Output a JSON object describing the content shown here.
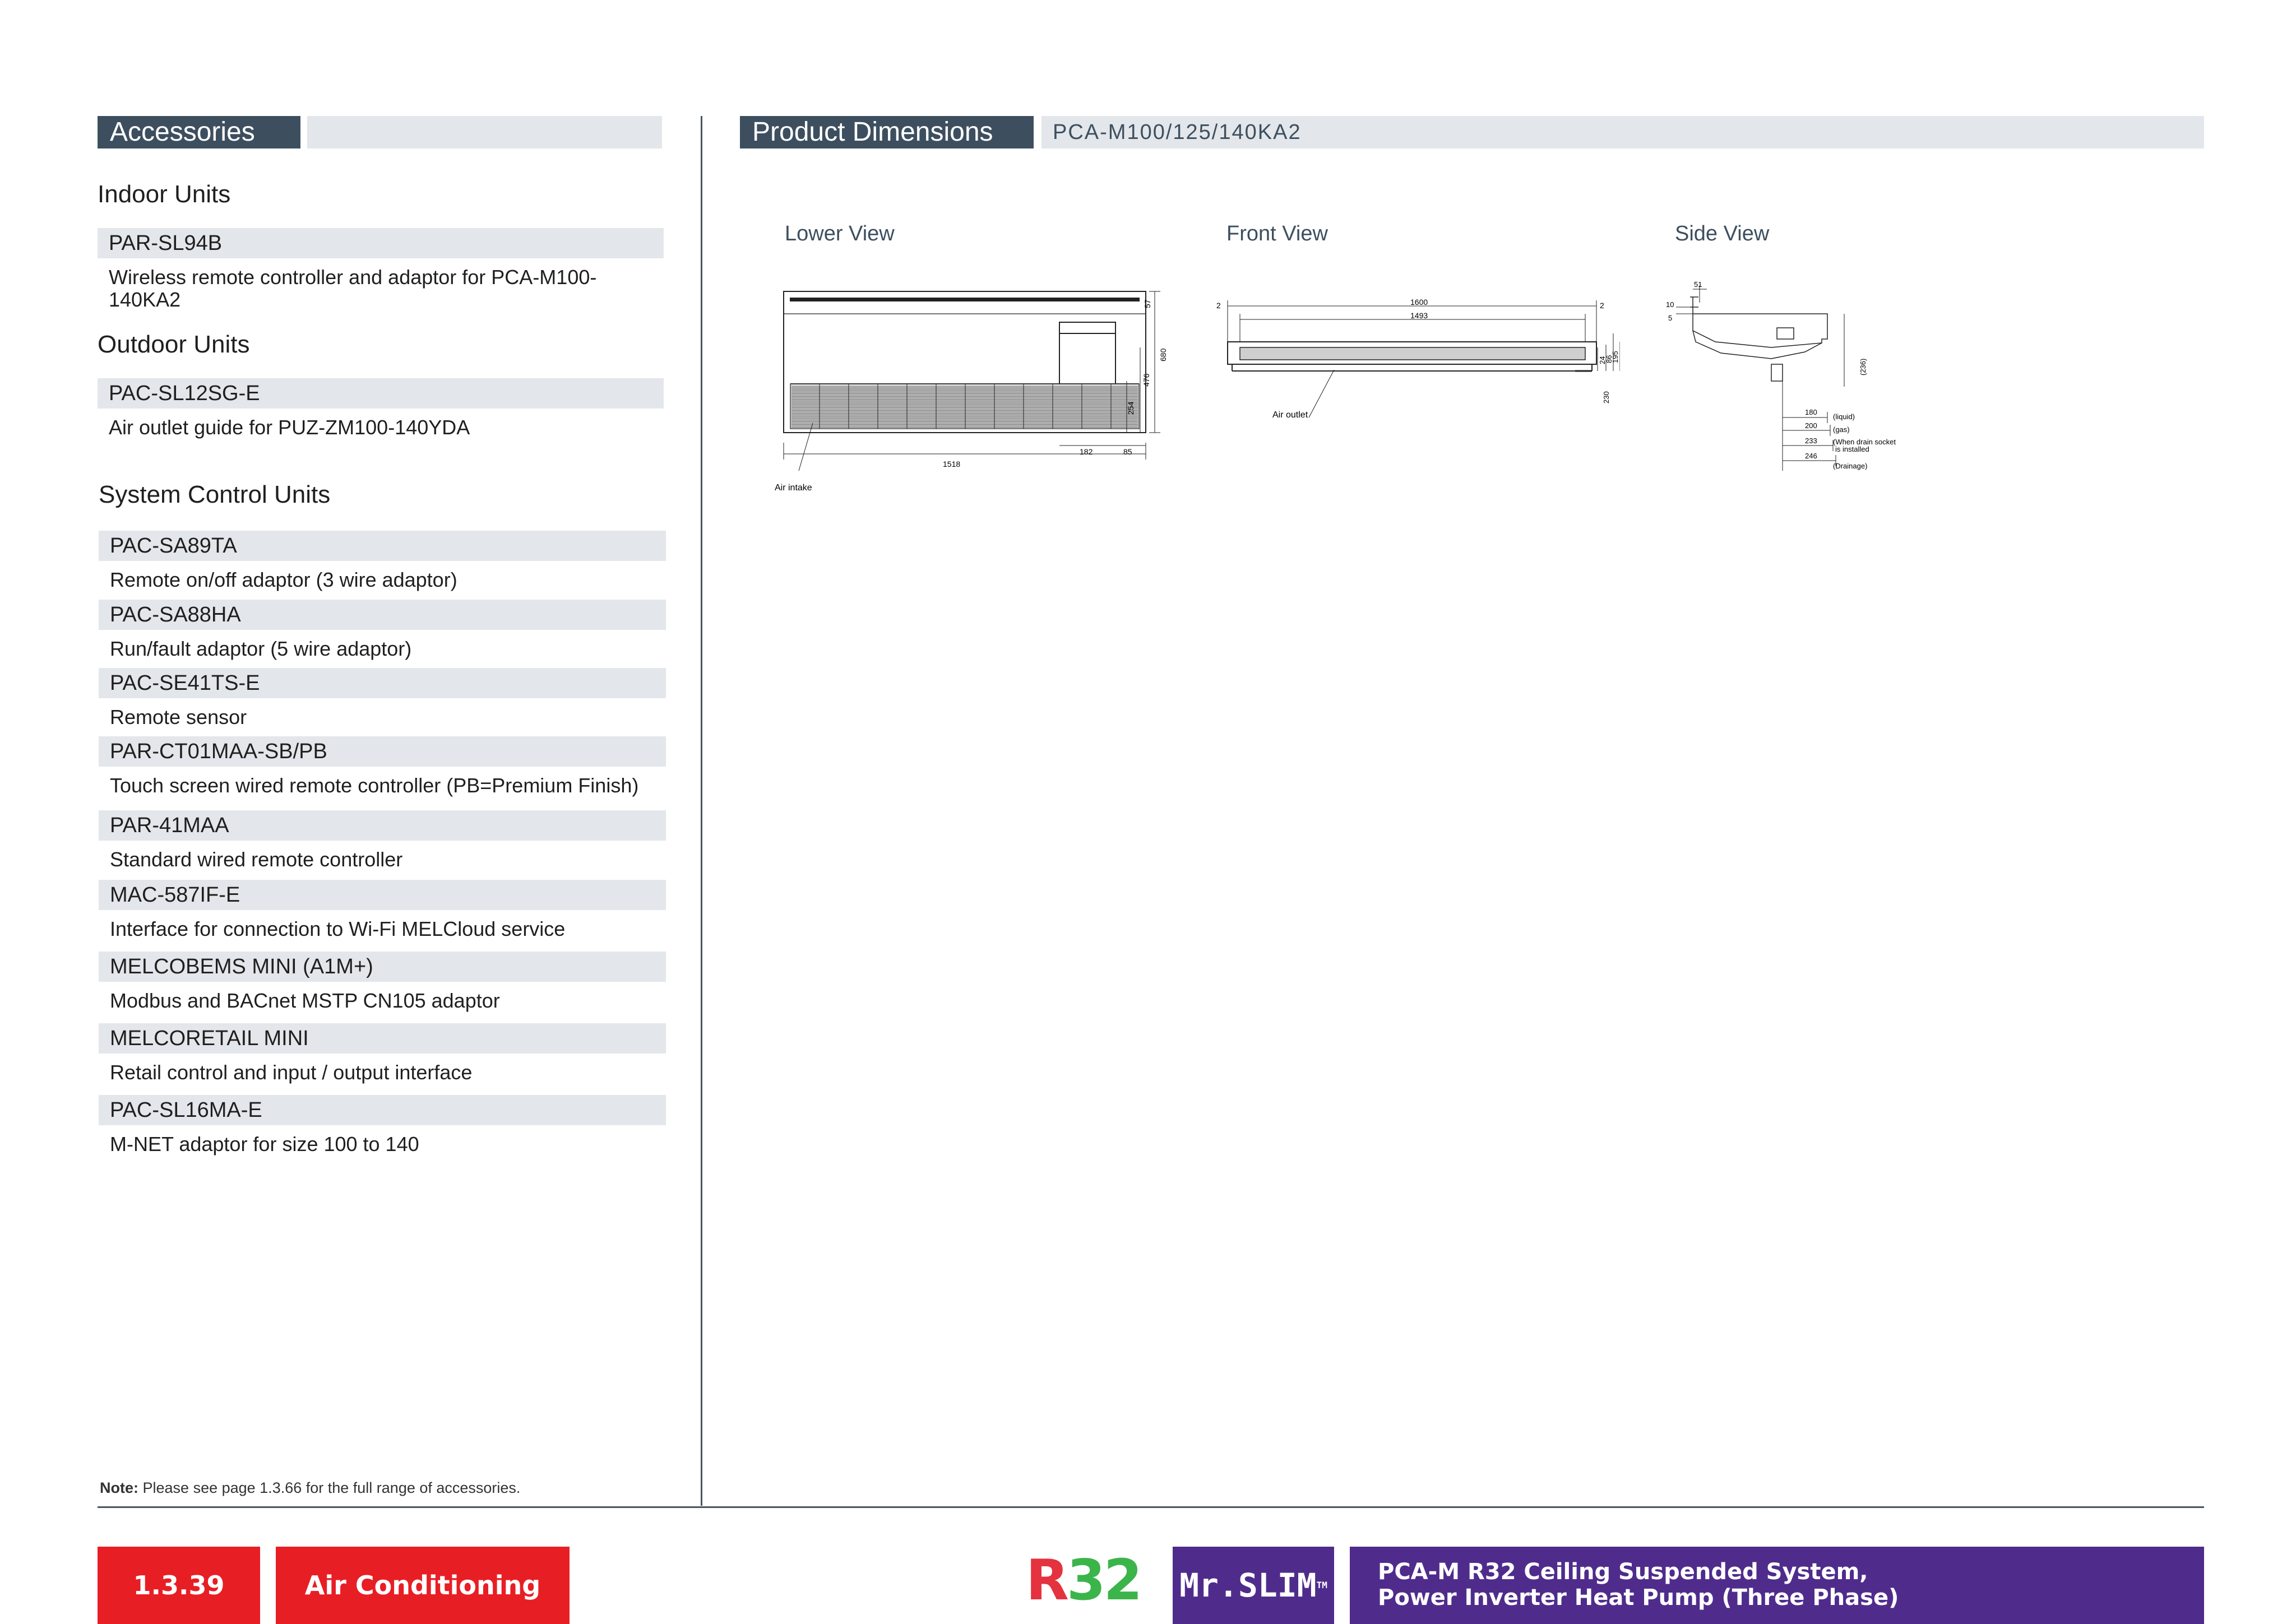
{
  "accessories": {
    "header": "Accessories",
    "indoor": {
      "title": "Indoor Units",
      "items": [
        {
          "code": "PAR-SL94B",
          "desc": "Wireless remote controller and adaptor for PCA-M100-140KA2"
        }
      ]
    },
    "outdoor": {
      "title": "Outdoor Units",
      "items": [
        {
          "code": "PAC-SL12SG-E",
          "desc": "Air outlet guide for PUZ-ZM100-140YDA"
        }
      ]
    },
    "system": {
      "title": "System Control Units",
      "items": [
        {
          "code": "PAC-SA89TA",
          "desc": "Remote on/off adaptor (3 wire adaptor)"
        },
        {
          "code": "PAC-SA88HA",
          "desc": "Run/fault adaptor (5 wire adaptor)"
        },
        {
          "code": "PAC-SE41TS-E",
          "desc": "Remote sensor"
        },
        {
          "code": "PAR-CT01MAA-SB/PB",
          "desc": "Touch screen wired remote controller (PB=Premium Finish)"
        },
        {
          "code": "PAR-41MAA",
          "desc": "Standard wired remote controller"
        },
        {
          "code": "MAC-587IF-E",
          "desc": "Interface for connection to Wi-Fi MELCloud service"
        },
        {
          "code": "MELCOBEMS MINI (A1M+)",
          "desc": "Modbus and BACnet MSTP CN105 adaptor"
        },
        {
          "code": "MELCORETAIL MINI",
          "desc": "Retail control and input / output interface"
        },
        {
          "code": "PAC-SL16MA-E",
          "desc": "M-NET adaptor for size 100 to 140"
        }
      ]
    },
    "note_label": "Note:",
    "note_text": "Please see page 1.3.66 for the full range of accessories."
  },
  "dimensions": {
    "header": "Product Dimensions",
    "model": "PCA-M100/125/140KA2",
    "lower_view": {
      "title": "Lower View",
      "labels": {
        "d680": "680",
        "d476": "476",
        "d57": "57",
        "d254": "254",
        "d182": "182",
        "d85": "85",
        "d1518": "1518",
        "air_intake": "Air intake"
      }
    },
    "front_view": {
      "title": "Front View",
      "labels": {
        "d1600": "1600",
        "d1493": "1493",
        "d2a": "2",
        "d2b": "2",
        "d230": "230",
        "d195": "195",
        "d86": "86",
        "d24": "24",
        "air_outlet": "Air outlet"
      }
    },
    "side_view": {
      "title": "Side View",
      "labels": {
        "d51": "51",
        "d10": "10",
        "d5": "5",
        "d236": "(236)",
        "d180": "180",
        "d200": "200",
        "d233": "233",
        "d246": "246",
        "liquid": "(liquid)",
        "gas": "(gas)",
        "drain1": "(When drain socket",
        "drain2": "is installed",
        "drainage": "(Drainage)"
      }
    }
  },
  "footer": {
    "page_number": "1.3.39",
    "section": "Air Conditioning",
    "logo_r": "R",
    "logo_32": "32",
    "logo_mrslim": "Mr.SLIM",
    "logo_tm": "TM",
    "title_line1": "PCA-M R32 Ceiling Suspended System,",
    "title_line2": "Power Inverter Heat Pump (Three Phase)"
  },
  "colors": {
    "header_dark": "#3d4f5f",
    "header_light": "#e3e6ea",
    "footer_red": "#e81e25",
    "footer_purple": "#4f2c8c",
    "logo_r_red": "#e4323f",
    "logo_32_green": "#3bb54a"
  }
}
